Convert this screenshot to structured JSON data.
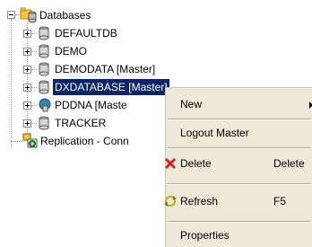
{
  "tree": {
    "root_label": "Databases",
    "databases": [
      {
        "label": "DEFAULTDB"
      },
      {
        "label": "DEMO"
      },
      {
        "label": "DEMODATA [Master]"
      },
      {
        "label": "DXDATABASE [Master]"
      },
      {
        "label": "PDDNA [Maste"
      },
      {
        "label": "TRACKER"
      }
    ],
    "replication_label": "Replication - Conn"
  },
  "menu": {
    "new_label": "New",
    "logout_label": "Logout Master",
    "delete_label": "Delete",
    "delete_shortcut": "Delete",
    "refresh_label": "Refresh",
    "refresh_shortcut": "F5",
    "properties_label": "Properties"
  },
  "colors": {
    "selection_bg": "#0a246a",
    "menu_bg": "#ece9d8",
    "delete_icon": "#d42020",
    "db_icon": "#7a7a7a"
  }
}
